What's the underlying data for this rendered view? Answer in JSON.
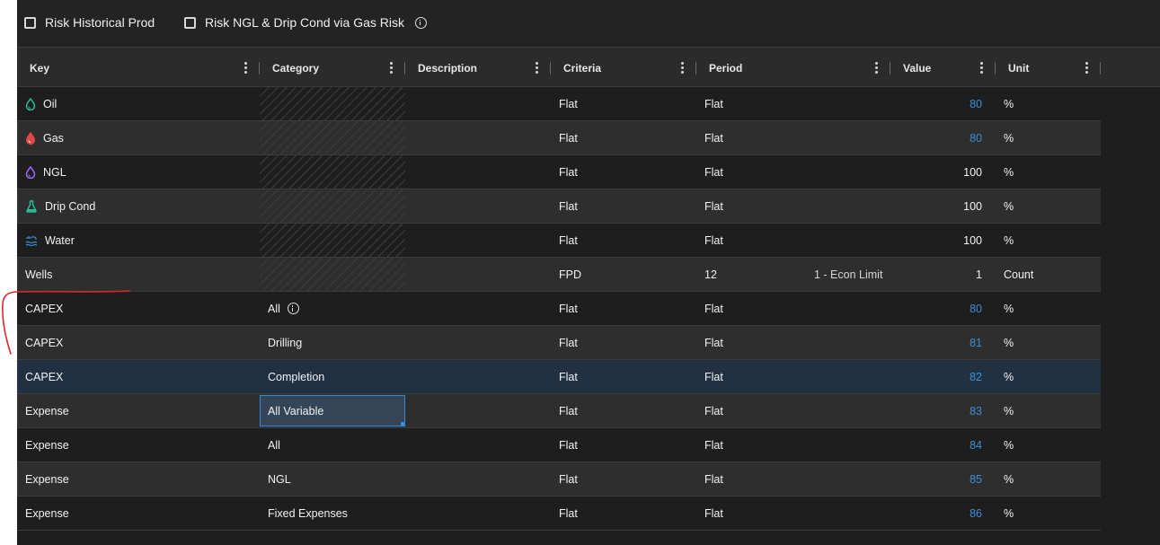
{
  "toolbar": {
    "risk_historical_label": "Risk Historical Prod",
    "risk_ngl_label": "Risk NGL & Drip Cond via Gas Risk"
  },
  "columns": [
    "Key",
    "Category",
    "Description",
    "Criteria",
    "Period",
    "Value",
    "Unit"
  ],
  "colors": {
    "oil": "#2bbf9a",
    "gas": "#e04747",
    "ngl": "#9b6bff",
    "drip": "#2bbf9a",
    "water": "#3b8fd9",
    "link_value": "#3b8fd9",
    "annotation": "#d62a2a"
  },
  "rows": [
    {
      "key": "Oil",
      "icon": "drop-icon",
      "category": "",
      "criteria": "Flat",
      "period": "Flat",
      "period_extra": "",
      "value": "80",
      "unit": "%"
    },
    {
      "key": "Gas",
      "icon": "drop-icon",
      "category": "",
      "criteria": "Flat",
      "period": "Flat",
      "period_extra": "",
      "value": "80",
      "unit": "%"
    },
    {
      "key": "NGL",
      "icon": "drop-icon",
      "category": "",
      "criteria": "Flat",
      "period": "Flat",
      "period_extra": "",
      "value": "100",
      "unit": "%"
    },
    {
      "key": "Drip Cond",
      "icon": "flask-icon",
      "category": "",
      "criteria": "Flat",
      "period": "Flat",
      "period_extra": "",
      "value": "100",
      "unit": "%"
    },
    {
      "key": "Water",
      "icon": "water-tap-icon",
      "category": "",
      "criteria": "Flat",
      "period": "Flat",
      "period_extra": "",
      "value": "100",
      "unit": "%"
    },
    {
      "key": "Wells",
      "icon": "",
      "category": "",
      "criteria": "FPD",
      "period": "12",
      "period_extra": "1 - Econ Limit",
      "value": "1",
      "unit": "Count"
    },
    {
      "key": "CAPEX",
      "icon": "",
      "category": "All",
      "criteria": "Flat",
      "period": "Flat",
      "period_extra": "",
      "value": "80",
      "unit": "%"
    },
    {
      "key": "CAPEX",
      "icon": "",
      "category": "Drilling",
      "criteria": "Flat",
      "period": "Flat",
      "period_extra": "",
      "value": "81",
      "unit": "%"
    },
    {
      "key": "CAPEX",
      "icon": "",
      "category": "Completion",
      "criteria": "Flat",
      "period": "Flat",
      "period_extra": "",
      "value": "82",
      "unit": "%"
    },
    {
      "key": "Expense",
      "icon": "",
      "category": "All Variable",
      "criteria": "Flat",
      "period": "Flat",
      "period_extra": "",
      "value": "83",
      "unit": "%"
    },
    {
      "key": "Expense",
      "icon": "",
      "category": "All",
      "criteria": "Flat",
      "period": "Flat",
      "period_extra": "",
      "value": "84",
      "unit": "%"
    },
    {
      "key": "Expense",
      "icon": "",
      "category": "NGL",
      "criteria": "Flat",
      "period": "Flat",
      "period_extra": "",
      "value": "85",
      "unit": "%"
    },
    {
      "key": "Expense",
      "icon": "",
      "category": "Fixed Expenses",
      "criteria": "Flat",
      "period": "Flat",
      "period_extra": "",
      "value": "86",
      "unit": "%"
    }
  ]
}
